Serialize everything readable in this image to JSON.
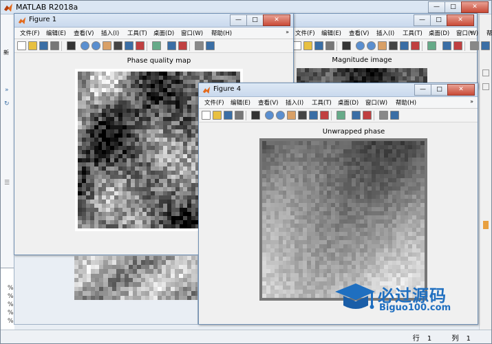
{
  "main": {
    "title": "MATLAB R2018a",
    "left_glyphs": [
      "新",
      "»",
      "↻",
      "☰"
    ],
    "cmd_lines": [
      "%",
      "%",
      "%",
      "%",
      "%"
    ],
    "status": {
      "row_label": "行",
      "row_value": "1",
      "col_label": "列",
      "col_value": "1"
    }
  },
  "menu": [
    "文件(F)",
    "编辑(E)",
    "查看(V)",
    "插入(I)",
    "工具(T)",
    "桌面(D)",
    "窗口(W)",
    "帮助(H)"
  ],
  "figures": {
    "fig1": {
      "title": "Figure 1",
      "axes_title": "Phase quality map"
    },
    "fig2": {
      "title": "",
      "axes_title": "Magnitude image"
    },
    "fig4": {
      "title": "Figure 4",
      "axes_title": "Unwrapped phase"
    }
  },
  "toolbar_icons": [
    "new-file-icon",
    "open-file-icon",
    "save-icon",
    "print-icon",
    "pointer-icon",
    "zoom-in-icon",
    "zoom-out-icon",
    "pan-hand-icon",
    "rotate-3d-icon",
    "data-cursor-icon",
    "brush-icon",
    "link-plot-icon",
    "colorbar-icon",
    "legend-icon",
    "hide-plot-tools-icon",
    "show-plot-tools-icon"
  ],
  "watermark": {
    "line1": "必过源码",
    "line2": "Biguo100.com"
  },
  "colors": {
    "title_bar": "#dbe6f3",
    "close_button": "#c94a37",
    "figure_bg": "#f0f0f0",
    "watermark_blue": "#1f6fc0"
  }
}
